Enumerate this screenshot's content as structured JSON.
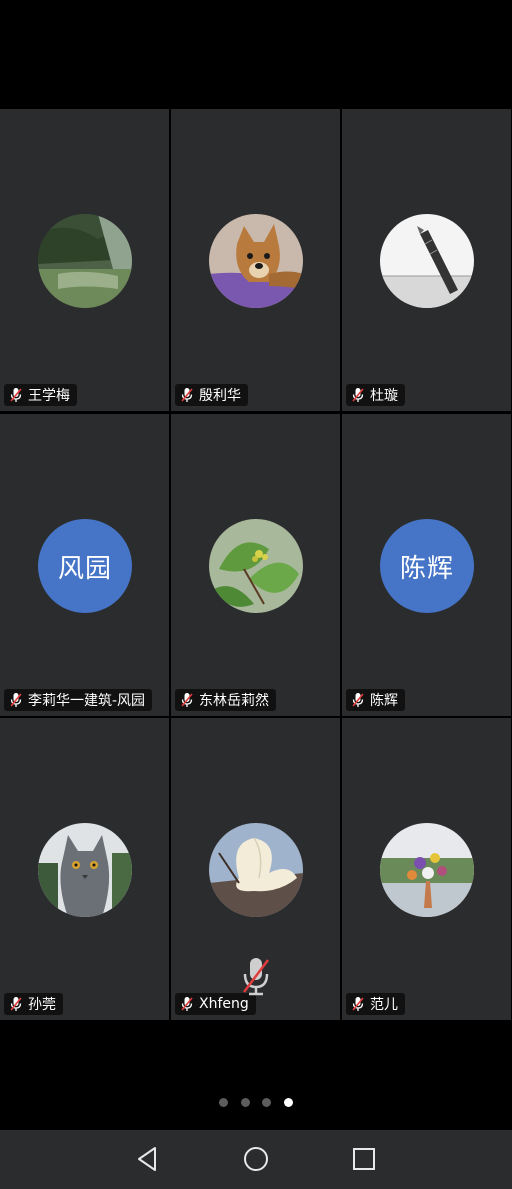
{
  "participants": [
    {
      "name": "王学梅",
      "avatar": "landscape-river-photo"
    },
    {
      "name": "殷利华",
      "avatar": "dog-photo"
    },
    {
      "name": "杜璇",
      "avatar": "pen-sketch-photo"
    },
    {
      "name": "李莉华一建筑-风园",
      "avatar_text": "风园",
      "avatar_color": "#4674c6"
    },
    {
      "name": "东林岳莉然",
      "avatar": "green-leaves-photo"
    },
    {
      "name": "陈辉",
      "avatar_text": "陈辉",
      "avatar_color": "#4674c6"
    },
    {
      "name": "孙莞",
      "avatar": "grey-cat-photo"
    },
    {
      "name": "Xhfeng",
      "avatar": "magnolia-flower-photo"
    },
    {
      "name": "范儿",
      "avatar": "flower-bouquet-photo"
    }
  ],
  "mute_indicator_icon": "mic-muted-icon",
  "pagination": {
    "total": 4,
    "active": 4
  },
  "nav": {
    "back": "back-triangle-icon",
    "home": "home-circle-icon",
    "recents": "recents-square-icon"
  }
}
